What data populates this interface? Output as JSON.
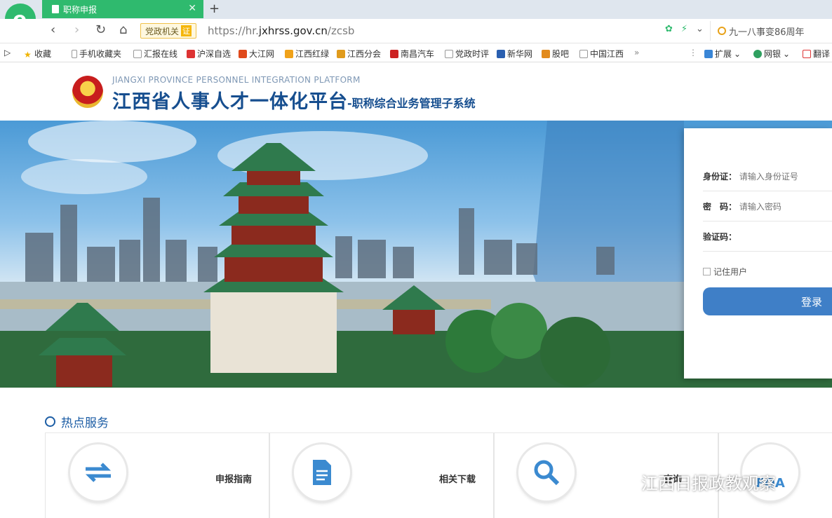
{
  "browser": {
    "tab_title": "职称申报",
    "url_prefix": "https://hr.",
    "url_host": "jxhrss.gov.cn",
    "url_path": "/zcsb",
    "secure_label": "党政机关",
    "secure_badge": "证",
    "search_text": "九一八事变86周年",
    "bookmarks": [
      "收藏",
      "手机收藏夹",
      "汇报在线",
      "沪深自选",
      "大江网",
      "江西红绿",
      "江西分会",
      "南昌汽车",
      "党政时评",
      "新华网",
      "股吧",
      "中国江西"
    ],
    "ext_items": [
      "扩展",
      "网银",
      "翻译"
    ]
  },
  "site": {
    "title_en": "JIANGXI PROVINCE PERSONNEL INTEGRATION PLATFORM",
    "title_cn": "江西省人事人才一体化平台",
    "title_sub": "-职称综合业务管理子系统"
  },
  "login": {
    "id_label": "身份证：",
    "id_placeholder": "请输入身份证号",
    "pwd_label": "密　码：",
    "pwd_placeholder": "请输入密码",
    "captcha_label": "验证码：",
    "remember_label": "记住用户",
    "submit_label": "登录"
  },
  "hot": {
    "title": "热点服务",
    "cards": [
      {
        "label": "申报指南"
      },
      {
        "label": "相关下载"
      },
      {
        "label": "查询"
      },
      {
        "label": "FQA"
      }
    ]
  },
  "watermark": "江西日报政教观察",
  "colors": {
    "brand_blue": "#164e8f",
    "tab_green": "#2fba6e",
    "button_blue": "#3f7fc7"
  }
}
